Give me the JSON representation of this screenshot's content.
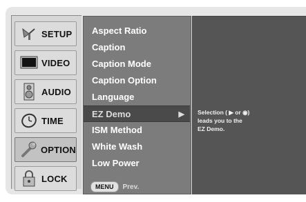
{
  "main_menu": [
    {
      "label": "SETUP",
      "icon": "antenna-icon"
    },
    {
      "label": "VIDEO",
      "icon": "tv-screen-icon"
    },
    {
      "label": "AUDIO",
      "icon": "speaker-icon"
    },
    {
      "label": "TIME",
      "icon": "clock-icon"
    },
    {
      "label": "OPTION",
      "icon": "wrench-icon"
    },
    {
      "label": "LOCK",
      "icon": "padlock-icon"
    }
  ],
  "active_main": "OPTION",
  "submenu": [
    "Aspect Ratio",
    "Caption",
    "Caption Mode",
    "Caption Option",
    "Language",
    "EZ Demo",
    "ISM Method",
    "White Wash",
    "Low Power"
  ],
  "selected_submenu": "EZ Demo",
  "selected_arrow": "▶",
  "footer": {
    "menu_key": "MENU",
    "prev": "Prev."
  },
  "info": {
    "line1": "Selection ( ▶ or ◉)",
    "line2": "leads you to the",
    "line3": "EZ Demo."
  },
  "colors": {
    "submenu_bg": "#7c7c7c",
    "selected_bg": "#4a4a4a",
    "info_bg": "#555555"
  }
}
